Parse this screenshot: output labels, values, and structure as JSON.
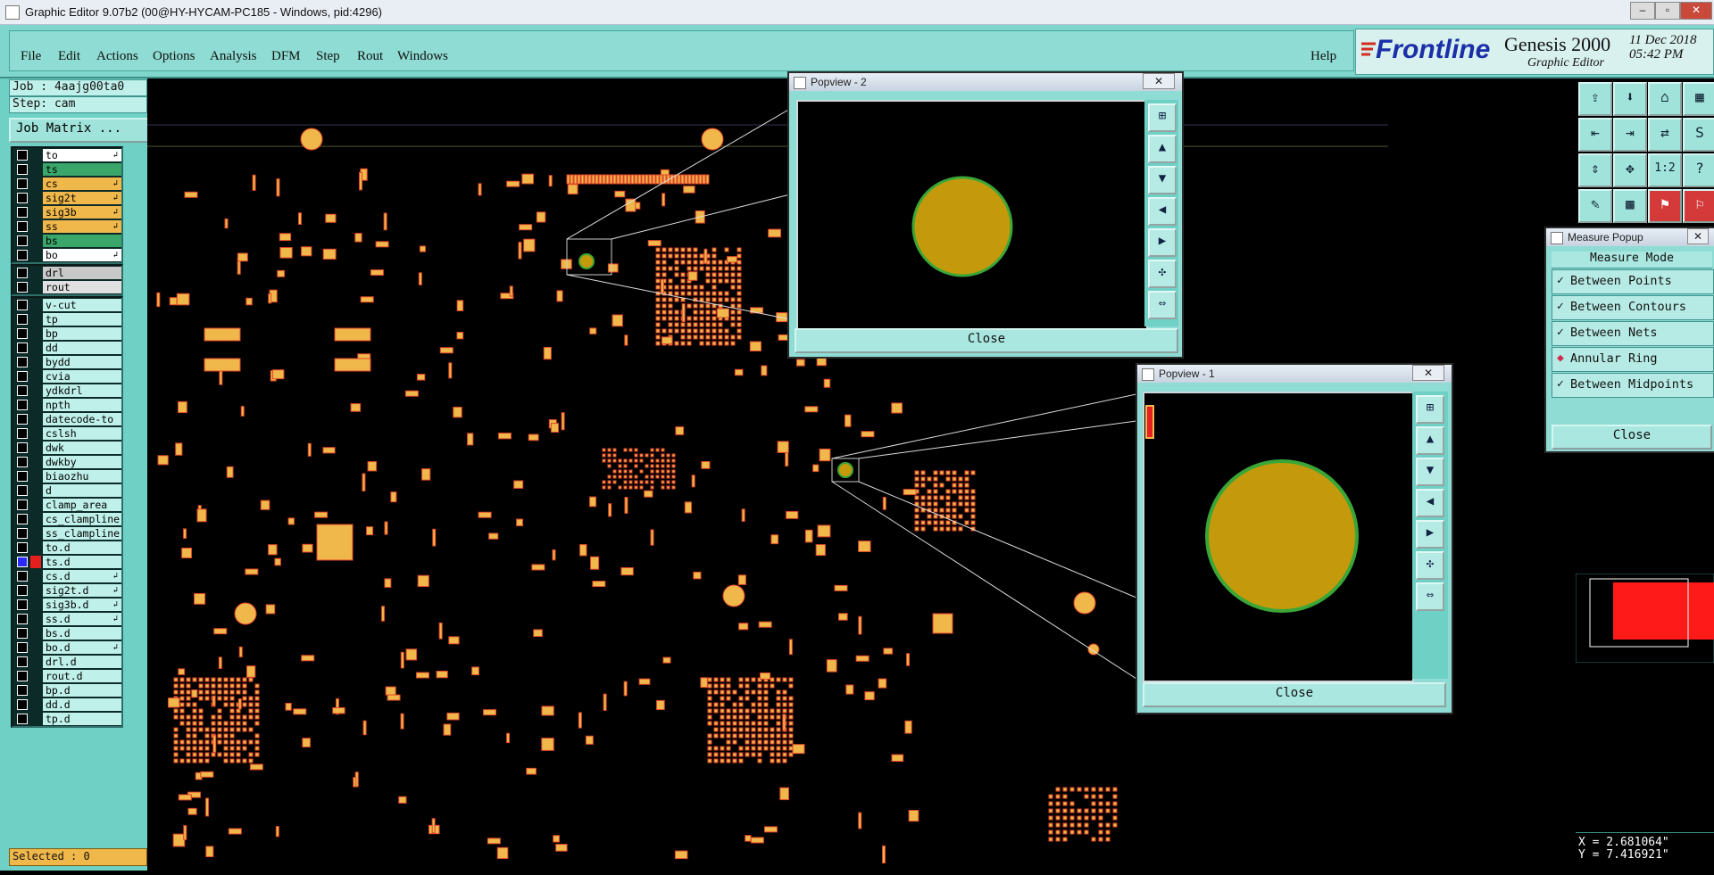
{
  "window": {
    "title": "Graphic Editor 9.07b2 (00@HY-HYCAM-PC185 - Windows, pid:4296)"
  },
  "menu": {
    "items": [
      "File",
      "Edit",
      "Actions",
      "Options",
      "Analysis",
      "DFM",
      "Step",
      "Rout",
      "Windows"
    ],
    "help": "Help"
  },
  "brand": {
    "logo": "Frontline",
    "product": "Genesis 2000",
    "subtitle": "Graphic Editor",
    "date": "11 Dec 2018",
    "time": "05:42 PM"
  },
  "job": {
    "job_label": "Job : 4aajg00ta0",
    "step_label": "Step: cam",
    "matrix_button": "Job Matrix ..."
  },
  "layers_group1": [
    {
      "name": "to",
      "color": "#ffffff",
      "arrow": true
    },
    {
      "name": "ts",
      "color": "#3aa66a",
      "arrow": false
    },
    {
      "name": "cs",
      "color": "#f0b84a",
      "arrow": true
    },
    {
      "name": "sig2t",
      "color": "#f0b84a",
      "arrow": true
    },
    {
      "name": "sig3b",
      "color": "#f0b84a",
      "arrow": true
    },
    {
      "name": "ss",
      "color": "#f0b84a",
      "arrow": true
    },
    {
      "name": "bs",
      "color": "#3aa66a",
      "arrow": false
    },
    {
      "name": "bo",
      "color": "#ffffff",
      "arrow": true
    }
  ],
  "layers_group2": [
    {
      "name": "drl",
      "color": "#c8c8c8",
      "arrow": false
    },
    {
      "name": "rout",
      "color": "#e0e0e0",
      "arrow": false
    }
  ],
  "layers_group3": [
    {
      "name": "v-cut",
      "color": "#bff0ea",
      "arrow": false
    },
    {
      "name": "tp",
      "color": "#bff0ea",
      "arrow": false
    },
    {
      "name": "bp",
      "color": "#bff0ea",
      "arrow": false
    },
    {
      "name": "dd",
      "color": "#bff0ea",
      "arrow": false
    },
    {
      "name": "bydd",
      "color": "#bff0ea",
      "arrow": false
    },
    {
      "name": "cvia",
      "color": "#bff0ea",
      "arrow": false
    },
    {
      "name": "ydkdrl",
      "color": "#bff0ea",
      "arrow": false
    },
    {
      "name": "npth",
      "color": "#bff0ea",
      "arrow": false
    },
    {
      "name": "datecode-to",
      "color": "#bff0ea",
      "arrow": false
    },
    {
      "name": "cslsh",
      "color": "#bff0ea",
      "arrow": false
    },
    {
      "name": "dwk",
      "color": "#bff0ea",
      "arrow": false
    },
    {
      "name": "dwkby",
      "color": "#bff0ea",
      "arrow": false
    },
    {
      "name": "biaozhu",
      "color": "#bff0ea",
      "arrow": false
    },
    {
      "name": "d",
      "color": "#bff0ea",
      "arrow": false
    },
    {
      "name": "clamp_area",
      "color": "#bff0ea",
      "arrow": false
    },
    {
      "name": "cs_clampline",
      "color": "#bff0ea",
      "arrow": false
    },
    {
      "name": "ss_clampline",
      "color": "#bff0ea",
      "arrow": false
    },
    {
      "name": "to.d",
      "color": "#bff0ea",
      "arrow": false
    },
    {
      "name": "ts.d",
      "color": "#bff0ea",
      "arrow": false,
      "active": true
    },
    {
      "name": "cs.d",
      "color": "#bff0ea",
      "arrow": true
    },
    {
      "name": "sig2t.d",
      "color": "#bff0ea",
      "arrow": true
    },
    {
      "name": "sig3b.d",
      "color": "#bff0ea",
      "arrow": true
    },
    {
      "name": "ss.d",
      "color": "#bff0ea",
      "arrow": true
    },
    {
      "name": "bs.d",
      "color": "#bff0ea",
      "arrow": false
    },
    {
      "name": "bo.d",
      "color": "#bff0ea",
      "arrow": true
    },
    {
      "name": "drl.d",
      "color": "#bff0ea",
      "arrow": false
    },
    {
      "name": "rout.d",
      "color": "#bff0ea",
      "arrow": false
    },
    {
      "name": "bp.d",
      "color": "#bff0ea",
      "arrow": false
    },
    {
      "name": "dd.d",
      "color": "#bff0ea",
      "arrow": false
    },
    {
      "name": "tp.d",
      "color": "#bff0ea",
      "arrow": false
    }
  ],
  "status": {
    "selected": "Selected : 0"
  },
  "popview2": {
    "title": "Popview - 2",
    "close": "Close"
  },
  "popview1": {
    "title": "Popview - 1",
    "close": "Close"
  },
  "measure": {
    "title": "Measure Popup",
    "mode_label": "Measure Mode",
    "items": [
      {
        "label": "Between Points",
        "mark": "✓"
      },
      {
        "label": "Between Contours",
        "mark": "✓"
      },
      {
        "label": "Between Nets",
        "mark": "✓"
      },
      {
        "label": "Annular Ring",
        "mark": "◆"
      },
      {
        "label": "Between Midpoints",
        "mark": "✓"
      }
    ],
    "close": "Close"
  },
  "coords": {
    "x": "X = 2.681064\"",
    "y": "Y = 7.416921\""
  },
  "colors": {
    "pad": "#f0b84a",
    "pad_edge": "#e0452a",
    "ring": "#3aa637",
    "ring_fill": "#c49a0c",
    "teal": "#6fd1c6"
  }
}
